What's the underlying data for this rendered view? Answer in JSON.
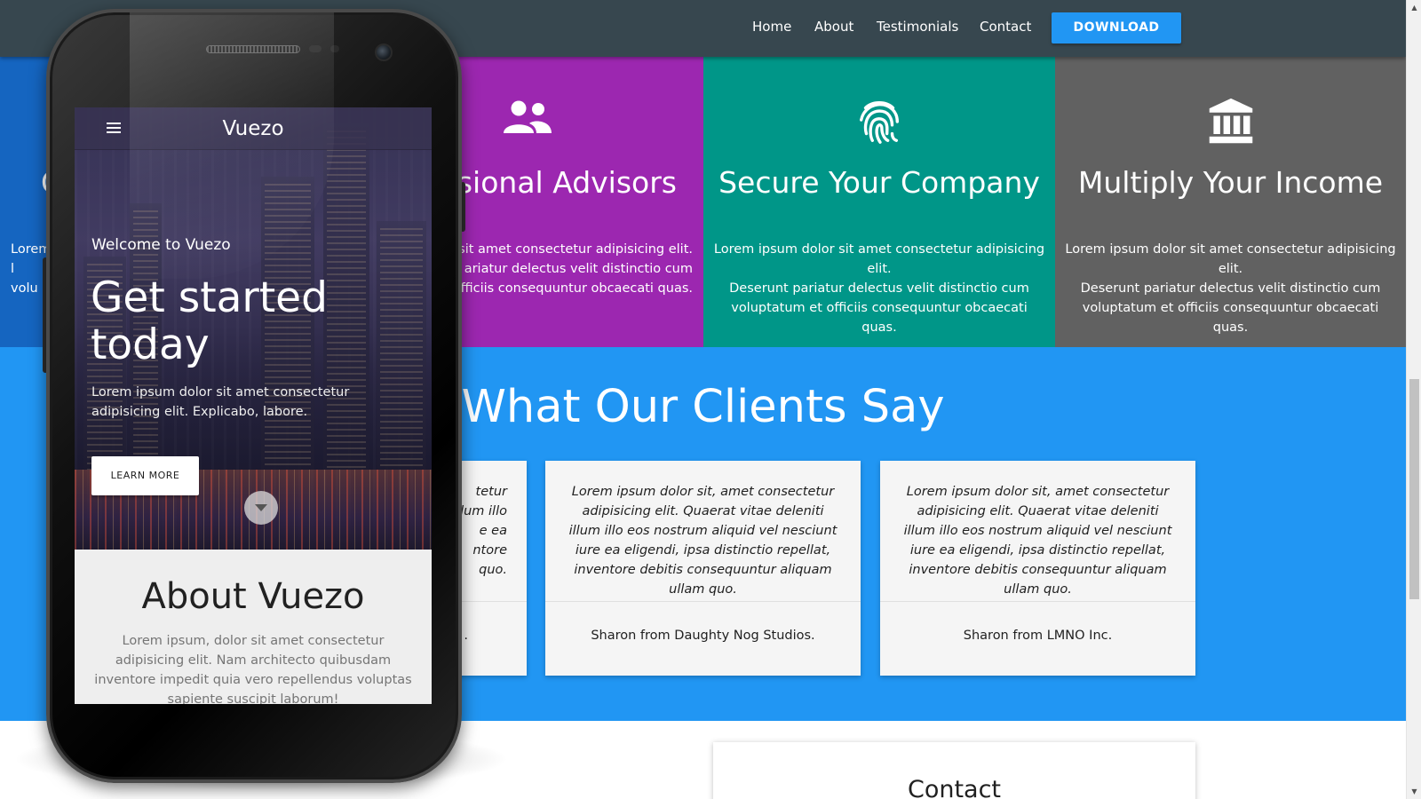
{
  "nav": {
    "links": [
      "Home",
      "About",
      "Testimonials",
      "Contact"
    ],
    "download_label": "DOWNLOAD"
  },
  "features": [
    {
      "title": "C",
      "text": "Lorem\nl\nvolu",
      "color": "#1565c0",
      "icon": "partial-hidden"
    },
    {
      "title": "ssional Advisors",
      "text": "lor sit amet consectetur adipisicing elit.\nariatur delectus velit distinctio cum\nofficiis consequuntur obcaecati quas.",
      "color": "#9c27b0",
      "icon": "people-icon"
    },
    {
      "title": "Secure Your Company",
      "text": "Lorem ipsum dolor sit amet consectetur adipisicing elit.\nDeserunt pariatur delectus velit distinctio cum\nvoluptatum et officiis consequuntur obcaecati quas.",
      "color": "#009688",
      "icon": "fingerprint-icon"
    },
    {
      "title": "Multiply Your Income",
      "text": "Lorem ipsum dolor sit amet consectetur adipisicing elit.\nDeserunt pariatur delectus velit distinctio cum\nvoluptatum et officiis consequuntur obcaecati quas.",
      "color": "#616161",
      "icon": "bank-icon"
    }
  ],
  "testimonials": {
    "title": "What Our Clients Say",
    "background": "#2196f3",
    "cards": [
      {
        "quote": "tetur\nlum illo\ne ea\nntore\nquo.",
        "author": "."
      },
      {
        "quote": "Lorem ipsum dolor sit, amet consectetur adipisicing elit. Quaerat vitae deleniti illum illo eos nostrum aliquid vel nesciunt iure ea eligendi, ipsa distinctio repellat, inventore debitis consequuntur aliquam ullam quo.",
        "author": "Sharon from Daughty Nog Studios."
      },
      {
        "quote": "Lorem ipsum dolor sit, amet consectetur adipisicing elit. Quaerat vitae deleniti illum illo eos nostrum aliquid vel nesciunt iure ea eligendi, ipsa distinctio repellat, inventore debitis consequuntur aliquam ullam quo.",
        "author": "Sharon from LMNO Inc."
      }
    ]
  },
  "contact": {
    "title": "Contact"
  },
  "phone_app": {
    "app_title": "Vuezo",
    "welcome": "Welcome to Vuezo",
    "heading": "Get started today",
    "text": "Lorem ipsum dolor sit amet consectetur adipisicing elit. Explicabo, labore.",
    "learn_more": "LEARN MORE",
    "about_title": "About Vuezo",
    "about_text": "Lorem ipsum, dolor sit amet consectetur adipisicing elit. Nam architecto quibusdam inventore impedit quia vero repellendus voluptas sapiente suscipit laborum!"
  },
  "colors": {
    "nav_bg": "#37474f",
    "accent": "#2196f3"
  }
}
